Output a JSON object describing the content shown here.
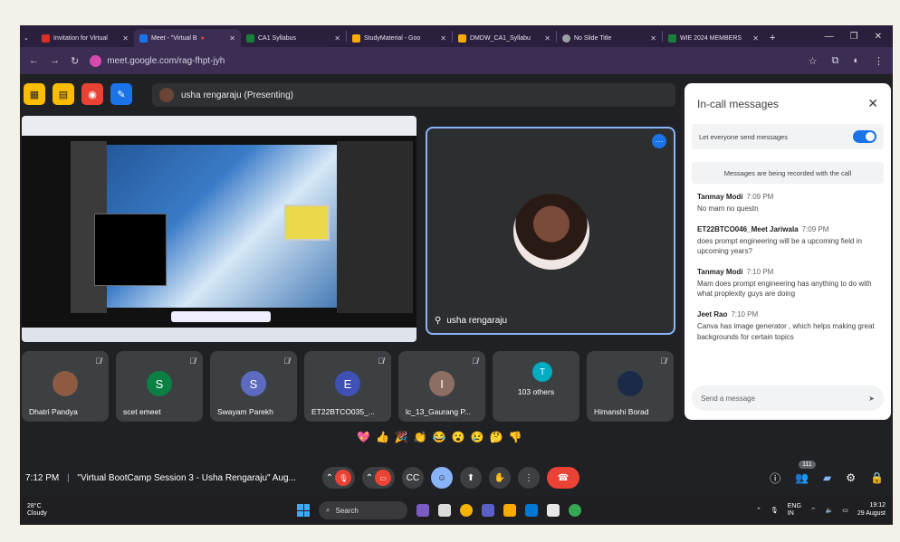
{
  "browser": {
    "tabs": [
      {
        "label": "Invitation for Virtual",
        "color": "#d93025",
        "active": false
      },
      {
        "label": "Meet - \"Virtual B",
        "color": "#1a73e8",
        "active": true
      },
      {
        "label": "CA1 Syllabus",
        "color": "#188038",
        "active": false
      },
      {
        "label": "StudyMaterial - Goo",
        "color": "#f9ab00",
        "active": false
      },
      {
        "label": "DMDW_CA1_Syllabu",
        "color": "#f9ab00",
        "active": false
      },
      {
        "label": "No Slide Title",
        "color": "#9aa0a6",
        "active": false
      },
      {
        "label": "WIE 2024 MEMBERS",
        "color": "#188038",
        "active": false
      }
    ],
    "url": "meet.google.com/rag-fhpt-jyh"
  },
  "meet": {
    "presenting_label": "usha rengaraju (Presenting)",
    "speaker_name": "usha rengaraju",
    "participants": [
      {
        "name": "Dhatri Pandya",
        "initial": "",
        "color": "#8d5a44"
      },
      {
        "name": "scet emeet",
        "initial": "S",
        "color": "#0b8043"
      },
      {
        "name": "Swayam Parekh",
        "initial": "S",
        "color": "#5c6bc0"
      },
      {
        "name": "ET22BTCO035_...",
        "initial": "E",
        "color": "#3f51b5"
      },
      {
        "name": "lc_13_Gaurang P...",
        "initial": "I",
        "color": "#8d6e63"
      },
      {
        "name": "103 others",
        "initial": "T",
        "color": "#00acc1"
      },
      {
        "name": "Himanshi Borad",
        "initial": "",
        "color": "#1b2a48"
      }
    ],
    "reactions": [
      "💖",
      "👍",
      "🎉",
      "👏",
      "😂",
      "😮",
      "😢",
      "🤔",
      "👎"
    ],
    "time": "7:12 PM",
    "meeting_title": "\"Virtual BootCamp Session 3 - Usha Rengaraju\" Aug...",
    "people_count": "111"
  },
  "chat": {
    "title": "In-call messages",
    "toggle_label": "Let everyone send messages",
    "record_note": "Messages are being recorded with the call",
    "messages": [
      {
        "author": "Tanmay Modi",
        "time": "7:09 PM",
        "text": "No mam no questn"
      },
      {
        "author": "ET22BTCO046_Meet Jariwala",
        "time": "7:09 PM",
        "text": "does prompt engineering will be a upcoming field in upcoming years?"
      },
      {
        "author": "Tanmay Modi",
        "time": "7:10 PM",
        "text": "Mam does prompt engineering has anything to do with what proplexity guys are doing"
      },
      {
        "author": "Jeet Rao",
        "time": "7:10 PM",
        "text": "Canva has image generator , which helps making great backgrounds for certain topics"
      }
    ],
    "send_placeholder": "Send a message"
  },
  "taskbar": {
    "temp": "28°C",
    "weather": "Cloudy",
    "search": "Search",
    "lang1": "ENG",
    "lang2": "IN",
    "clock_time": "19:12",
    "clock_date": "29 August"
  }
}
